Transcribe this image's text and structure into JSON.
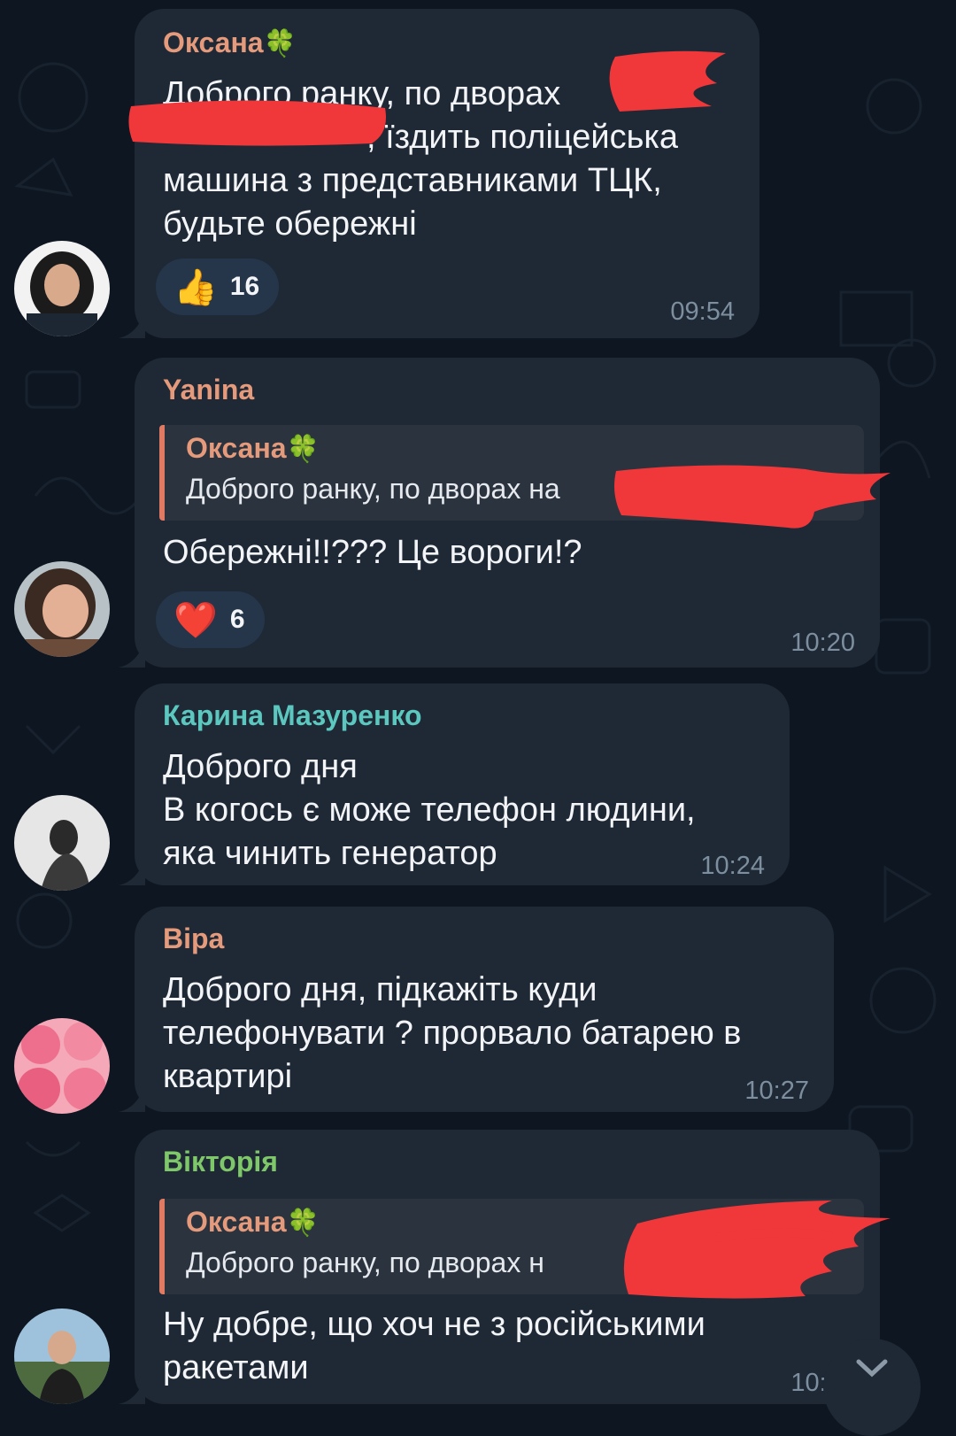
{
  "colors": {
    "background": "#0e1621",
    "bubble": "#1e2935",
    "name_oksana": "#e59a7c",
    "name_yanina": "#e59a7c",
    "name_karyna": "#5cc7bf",
    "name_vira": "#e59a7c",
    "name_viktoria": "#7fc86a",
    "redaction": "#f0373a"
  },
  "messages": [
    {
      "author": "Оксана",
      "author_emoji": "🍀",
      "lines": [
        "Доброго ранку, по дворах",
        ", їздить поліцейська",
        "машина з представниками ТЦК,",
        "будьте обережні"
      ],
      "reaction": {
        "emoji": "👍",
        "count": "16"
      },
      "time": "09:54"
    },
    {
      "author": "Yanina",
      "reply": {
        "author": "Оксана",
        "author_emoji": "🍀",
        "text": "Доброго ранку, по дворах на"
      },
      "lines": [
        "Обережні!!??? Це вороги!?"
      ],
      "reaction": {
        "emoji": "❤️",
        "count": "6"
      },
      "time": "10:20"
    },
    {
      "author": "Карина Мазуренко",
      "lines": [
        "Доброго дня",
        "В когось є може телефон людини,",
        "яка чинить генератор"
      ],
      "time": "10:24"
    },
    {
      "author": "Віра",
      "lines": [
        "Доброго дня, підкажіть куди",
        "телефонувати ? прорвало батарею в",
        "квартирі"
      ],
      "time": "10:27"
    },
    {
      "author": "Вікторія",
      "reply": {
        "author": "Оксана",
        "author_emoji": "🍀",
        "text": "Доброго ранку, по дворах н"
      },
      "lines": [
        "Ну добре, що хоч не з російськими",
        "ракетами"
      ],
      "time": "10:29"
    }
  ]
}
